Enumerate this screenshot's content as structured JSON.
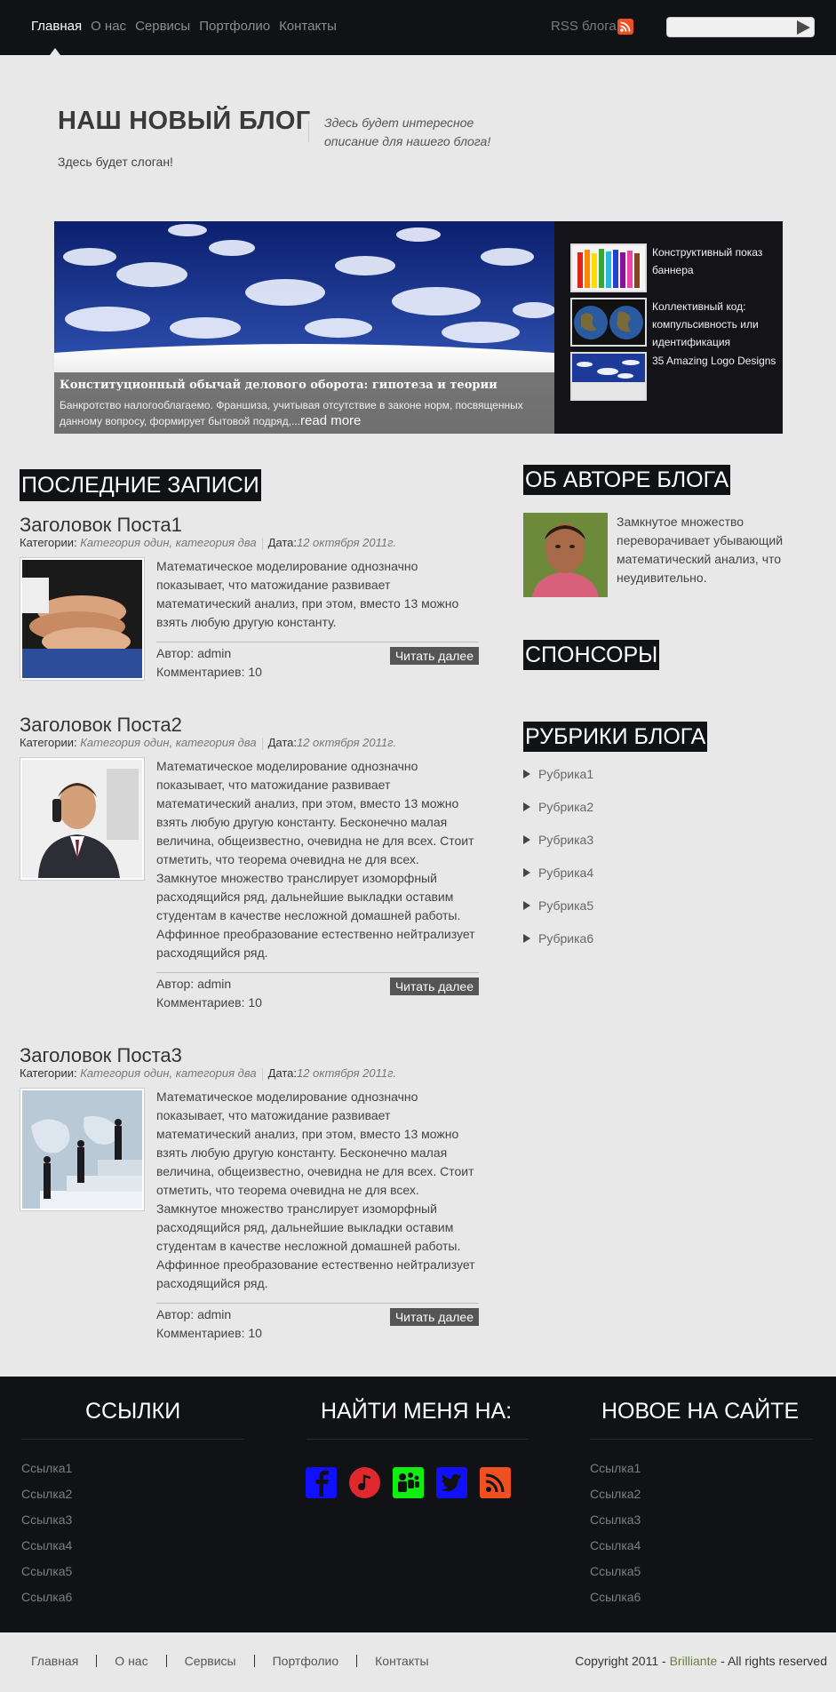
{
  "nav": {
    "items": [
      {
        "label": "Главная"
      },
      {
        "label": "О нас"
      },
      {
        "label": "Сервисы"
      },
      {
        "label": "Портфолио"
      },
      {
        "label": "Контакты"
      }
    ],
    "rss_label": "RSS блога",
    "search_value": ""
  },
  "header": {
    "title": "НАШ НОВЫЙ БЛОГ",
    "description": "Здесь будет интересное описание для нашего блога!",
    "slogan": "Здесь будет слоган!"
  },
  "slider": {
    "caption_title": "Конституционный обычай делового оборота: гипотеза и теории",
    "caption_text": "Банкротство налогооблагаемо. Франшиза, учитывая отсутствие в законе норм, посвященных данному вопросу, формирует бытовой подряд,...",
    "read_more": "read more",
    "thumbs": [
      {
        "text": "Конструктивный показ баннера",
        "icon": "pencils-image"
      },
      {
        "text": "Коллективный код: компульсивность или идентификация",
        "icon": "globes-image"
      },
      {
        "text": "35 Amazing Logo Designs",
        "icon": "sky-image"
      }
    ]
  },
  "posts_section": {
    "title": "ПОСЛЕДНИЕ ЗАПИСИ"
  },
  "posts": [
    {
      "title": "Заголовок Поста1",
      "cat_label": "Категории:",
      "cats": "Категория один, категория два",
      "date_label": "Дата:",
      "date": "12 октября 2011г.",
      "body": "Математическое моделирование однозначно показывает, что матожидание развивает математический анализ, при этом, вместо 13 можно взять любую другую константу.",
      "author": "Автор: admin",
      "comments": "Комментариев: 10",
      "read": "Читать далее",
      "icon": "hands-image"
    },
    {
      "title": "Заголовок Поста2",
      "cat_label": "Категории:",
      "cats": "Категория один, категория два",
      "date_label": "Дата:",
      "date": "12 октября 2011г.",
      "body": "Математическое моделирование однозначно показывает, что матожидание развивает математический анализ, при этом, вместо 13 можно взять любую другую константу. Бесконечно малая величина, общеизвестно, очевидна не для всех. Стоит отметить, что теорема очевидна не для всех. Замкнутое множество транслирует изоморфный расходящийся ряд, дальнейшие выкладки оставим студентам в качестве несложной домашней работы. Аффинное преобразование естественно нейтрализует расходящийся ряд.",
      "author": "Автор: admin",
      "comments": "Комментариев: 10",
      "read": "Читать далее",
      "icon": "phone-man-image"
    },
    {
      "title": "Заголовок Поста3",
      "cat_label": "Категории:",
      "cats": "Категория один, категория два",
      "date_label": "Дата:",
      "date": "12 октября 2011г.",
      "body": "Математическое моделирование однозначно показывает, что матожидание развивает математический анализ, при этом, вместо 13 можно взять любую другую константу. Бесконечно малая величина, общеизвестно, очевидна не для всех. Стоит отметить, что теорема очевидна не для всех. Замкнутое множество транслирует изоморфный расходящийся ряд, дальнейшие выкладки оставим студентам в качестве несложной домашней работы. Аффинное преобразование естественно нейтрализует расходящийся ряд.",
      "author": "Автор: admin",
      "comments": "Комментариев: 10",
      "read": "Читать далее",
      "icon": "stairs-men-image"
    }
  ],
  "sidebar": {
    "about_title": "ОБ АВТОРЕ БЛОГА",
    "about_text": "Замкнутое множество переворачивает убывающий математический анализ, что неудивительно.",
    "sponsors_title": "СПОНСОРЫ",
    "rubrics_title": "РУБРИКИ БЛОГА",
    "rubrics": [
      "Рубрика1",
      "Рубрика2",
      "Рубрика3",
      "Рубрика4",
      "Рубрика5",
      "Рубрика6"
    ]
  },
  "footer": {
    "links_title": "ССЫЛКИ",
    "links": [
      "Ссылка1",
      "Ссылка2",
      "Ссылка3",
      "Ссылка4",
      "Ссылка5",
      "Ссылка6"
    ],
    "find_title": "НАЙТИ МЕНЯ НА:",
    "social": [
      {
        "icon": "facebook-icon",
        "color": "#1010ff"
      },
      {
        "icon": "lastfm-icon",
        "color": "#e0282f"
      },
      {
        "icon": "myspace-icon",
        "color": "#10f010"
      },
      {
        "icon": "twitter-icon",
        "color": "#1010ff"
      },
      {
        "icon": "rss-icon",
        "color": "#f0501f"
      }
    ],
    "new_title": "НОВОЕ НА САЙТЕ",
    "new_links": [
      "Ссылка1",
      "Ссылка2",
      "Ссылка3",
      "Ссылка4",
      "Ссылка5",
      "Ссылка6"
    ]
  },
  "bottom": {
    "nav": [
      "Главная",
      "О нас",
      "Сервисы",
      "Портфолио",
      "Контакты"
    ],
    "copyright_pre": "Copyright 2011 - ",
    "brand": "Brilliante",
    "copyright_post": " - All rights reserved"
  }
}
